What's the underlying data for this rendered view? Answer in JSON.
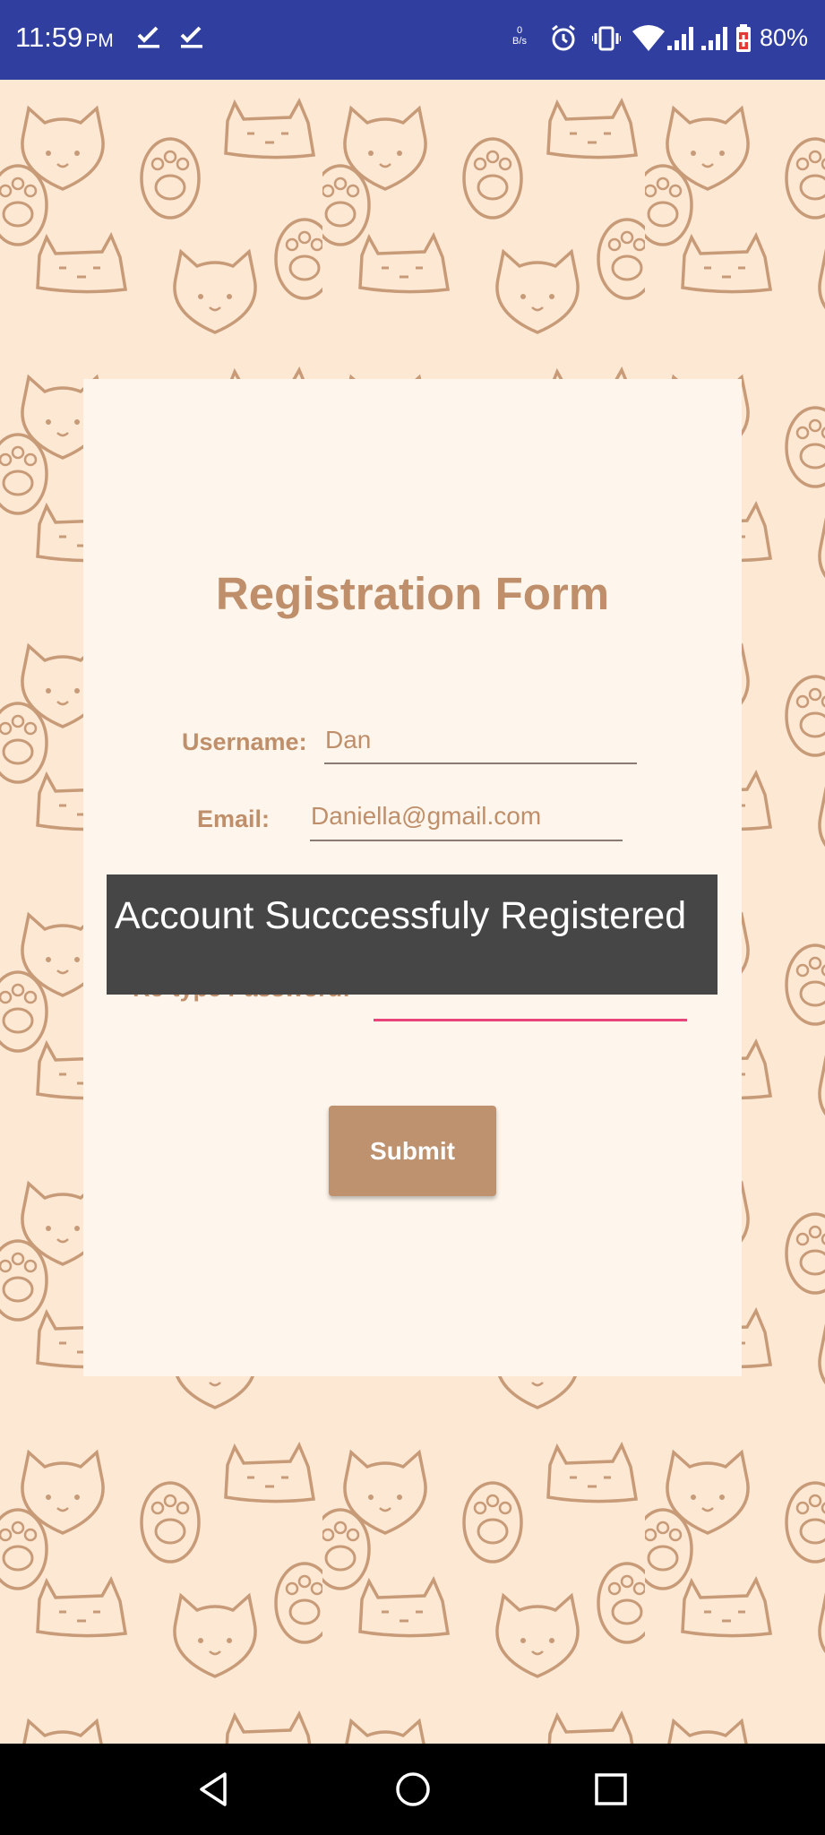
{
  "status_bar": {
    "time": "11:59",
    "ampm": "PM",
    "net_speed_value": "0",
    "net_speed_unit": "B/s",
    "battery_percent": "80%",
    "icons": [
      "check-icon",
      "check-icon",
      "alarm-icon",
      "vibrate-icon",
      "wifi-icon",
      "signal-icon",
      "signal-icon",
      "battery-icon"
    ]
  },
  "form": {
    "title": "Registration Form",
    "username_label": "Username:",
    "username_value": "Dan",
    "email_label": "Email:",
    "email_value": "Daniella@gmail.com",
    "retype_label": "Re-type Password:",
    "submit_label": "Submit"
  },
  "toast": {
    "message": "Account Succcessfuly Registered"
  },
  "colors": {
    "status_bar": "#303f9f",
    "accent_brown": "#be8f6a",
    "active_underline": "#e8437a",
    "toast_bg": "#464646"
  }
}
